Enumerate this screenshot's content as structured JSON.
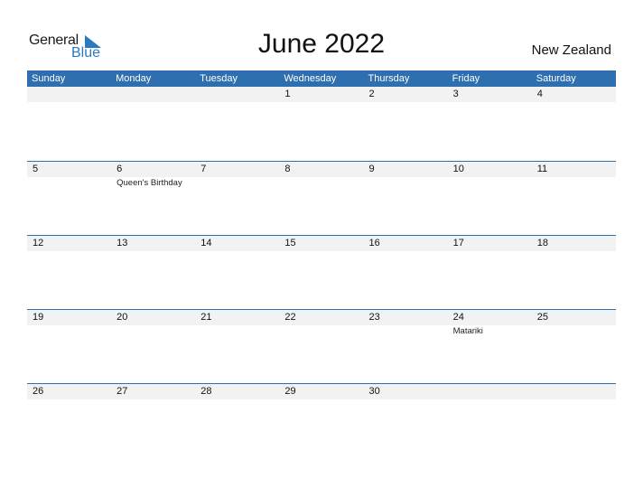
{
  "logo": {
    "general": "General",
    "blue": "Blue"
  },
  "title": "June 2022",
  "country": "New Zealand",
  "weekdays": [
    "Sunday",
    "Monday",
    "Tuesday",
    "Wednesday",
    "Thursday",
    "Friday",
    "Saturday"
  ],
  "weeks": [
    {
      "days": [
        "",
        "",
        "",
        "1",
        "2",
        "3",
        "4"
      ],
      "events": [
        "",
        "",
        "",
        "",
        "",
        "",
        ""
      ]
    },
    {
      "days": [
        "5",
        "6",
        "7",
        "8",
        "9",
        "10",
        "11"
      ],
      "events": [
        "",
        "Queen's Birthday",
        "",
        "",
        "",
        "",
        ""
      ]
    },
    {
      "days": [
        "12",
        "13",
        "14",
        "15",
        "16",
        "17",
        "18"
      ],
      "events": [
        "",
        "",
        "",
        "",
        "",
        "",
        ""
      ]
    },
    {
      "days": [
        "19",
        "20",
        "21",
        "22",
        "23",
        "24",
        "25"
      ],
      "events": [
        "",
        "",
        "",
        "",
        "",
        "Matariki",
        ""
      ]
    },
    {
      "days": [
        "26",
        "27",
        "28",
        "29",
        "30",
        "",
        ""
      ],
      "events": [
        "",
        "",
        "",
        "",
        "",
        "",
        ""
      ]
    }
  ],
  "colors": {
    "accent": "#2e6fb0",
    "strip": "#f2f2f2",
    "logo_blue": "#2a7abf"
  }
}
